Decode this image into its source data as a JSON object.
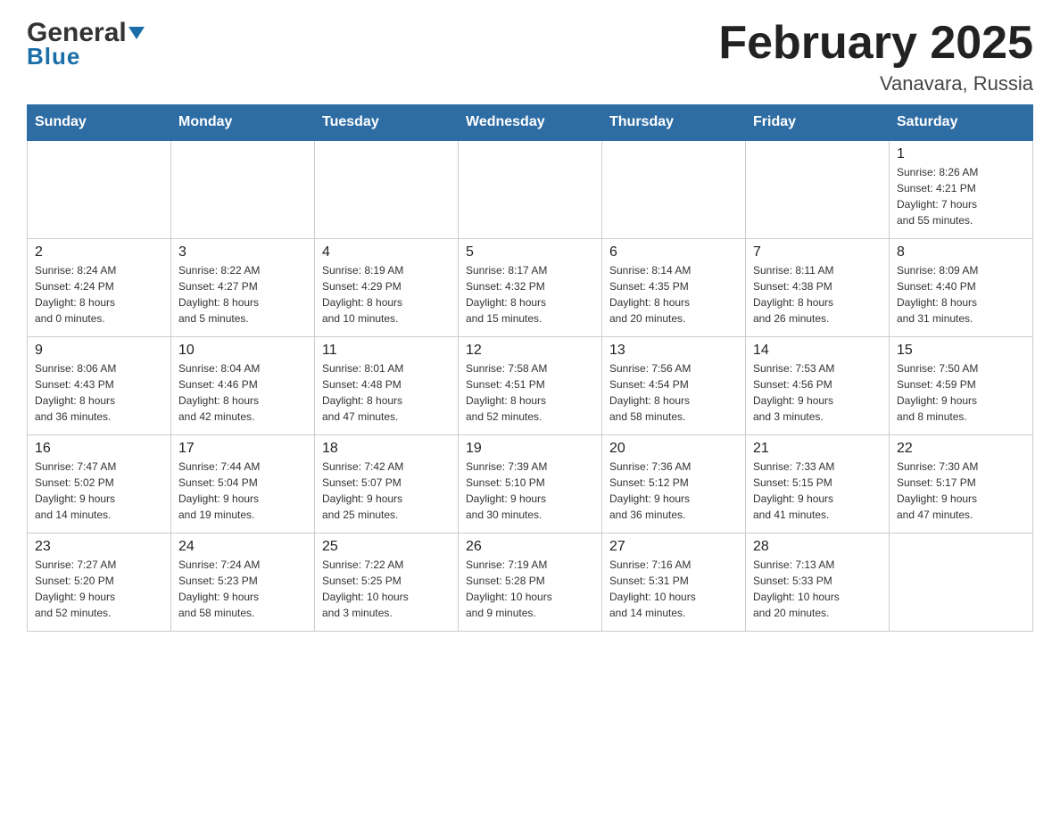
{
  "header": {
    "logo": {
      "general": "General",
      "blue": "Blue"
    },
    "title": "February 2025",
    "location": "Vanavara, Russia"
  },
  "weekdays": [
    "Sunday",
    "Monday",
    "Tuesday",
    "Wednesday",
    "Thursday",
    "Friday",
    "Saturday"
  ],
  "weeks": [
    [
      {
        "day": "",
        "info": ""
      },
      {
        "day": "",
        "info": ""
      },
      {
        "day": "",
        "info": ""
      },
      {
        "day": "",
        "info": ""
      },
      {
        "day": "",
        "info": ""
      },
      {
        "day": "",
        "info": ""
      },
      {
        "day": "1",
        "info": "Sunrise: 8:26 AM\nSunset: 4:21 PM\nDaylight: 7 hours\nand 55 minutes."
      }
    ],
    [
      {
        "day": "2",
        "info": "Sunrise: 8:24 AM\nSunset: 4:24 PM\nDaylight: 8 hours\nand 0 minutes."
      },
      {
        "day": "3",
        "info": "Sunrise: 8:22 AM\nSunset: 4:27 PM\nDaylight: 8 hours\nand 5 minutes."
      },
      {
        "day": "4",
        "info": "Sunrise: 8:19 AM\nSunset: 4:29 PM\nDaylight: 8 hours\nand 10 minutes."
      },
      {
        "day": "5",
        "info": "Sunrise: 8:17 AM\nSunset: 4:32 PM\nDaylight: 8 hours\nand 15 minutes."
      },
      {
        "day": "6",
        "info": "Sunrise: 8:14 AM\nSunset: 4:35 PM\nDaylight: 8 hours\nand 20 minutes."
      },
      {
        "day": "7",
        "info": "Sunrise: 8:11 AM\nSunset: 4:38 PM\nDaylight: 8 hours\nand 26 minutes."
      },
      {
        "day": "8",
        "info": "Sunrise: 8:09 AM\nSunset: 4:40 PM\nDaylight: 8 hours\nand 31 minutes."
      }
    ],
    [
      {
        "day": "9",
        "info": "Sunrise: 8:06 AM\nSunset: 4:43 PM\nDaylight: 8 hours\nand 36 minutes."
      },
      {
        "day": "10",
        "info": "Sunrise: 8:04 AM\nSunset: 4:46 PM\nDaylight: 8 hours\nand 42 minutes."
      },
      {
        "day": "11",
        "info": "Sunrise: 8:01 AM\nSunset: 4:48 PM\nDaylight: 8 hours\nand 47 minutes."
      },
      {
        "day": "12",
        "info": "Sunrise: 7:58 AM\nSunset: 4:51 PM\nDaylight: 8 hours\nand 52 minutes."
      },
      {
        "day": "13",
        "info": "Sunrise: 7:56 AM\nSunset: 4:54 PM\nDaylight: 8 hours\nand 58 minutes."
      },
      {
        "day": "14",
        "info": "Sunrise: 7:53 AM\nSunset: 4:56 PM\nDaylight: 9 hours\nand 3 minutes."
      },
      {
        "day": "15",
        "info": "Sunrise: 7:50 AM\nSunset: 4:59 PM\nDaylight: 9 hours\nand 8 minutes."
      }
    ],
    [
      {
        "day": "16",
        "info": "Sunrise: 7:47 AM\nSunset: 5:02 PM\nDaylight: 9 hours\nand 14 minutes."
      },
      {
        "day": "17",
        "info": "Sunrise: 7:44 AM\nSunset: 5:04 PM\nDaylight: 9 hours\nand 19 minutes."
      },
      {
        "day": "18",
        "info": "Sunrise: 7:42 AM\nSunset: 5:07 PM\nDaylight: 9 hours\nand 25 minutes."
      },
      {
        "day": "19",
        "info": "Sunrise: 7:39 AM\nSunset: 5:10 PM\nDaylight: 9 hours\nand 30 minutes."
      },
      {
        "day": "20",
        "info": "Sunrise: 7:36 AM\nSunset: 5:12 PM\nDaylight: 9 hours\nand 36 minutes."
      },
      {
        "day": "21",
        "info": "Sunrise: 7:33 AM\nSunset: 5:15 PM\nDaylight: 9 hours\nand 41 minutes."
      },
      {
        "day": "22",
        "info": "Sunrise: 7:30 AM\nSunset: 5:17 PM\nDaylight: 9 hours\nand 47 minutes."
      }
    ],
    [
      {
        "day": "23",
        "info": "Sunrise: 7:27 AM\nSunset: 5:20 PM\nDaylight: 9 hours\nand 52 minutes."
      },
      {
        "day": "24",
        "info": "Sunrise: 7:24 AM\nSunset: 5:23 PM\nDaylight: 9 hours\nand 58 minutes."
      },
      {
        "day": "25",
        "info": "Sunrise: 7:22 AM\nSunset: 5:25 PM\nDaylight: 10 hours\nand 3 minutes."
      },
      {
        "day": "26",
        "info": "Sunrise: 7:19 AM\nSunset: 5:28 PM\nDaylight: 10 hours\nand 9 minutes."
      },
      {
        "day": "27",
        "info": "Sunrise: 7:16 AM\nSunset: 5:31 PM\nDaylight: 10 hours\nand 14 minutes."
      },
      {
        "day": "28",
        "info": "Sunrise: 7:13 AM\nSunset: 5:33 PM\nDaylight: 10 hours\nand 20 minutes."
      },
      {
        "day": "",
        "info": ""
      }
    ]
  ],
  "colors": {
    "header_bg": "#2e6da4",
    "header_text": "#ffffff",
    "border": "#cccccc",
    "logo_dark": "#333333",
    "logo_blue": "#1a6ea8"
  }
}
